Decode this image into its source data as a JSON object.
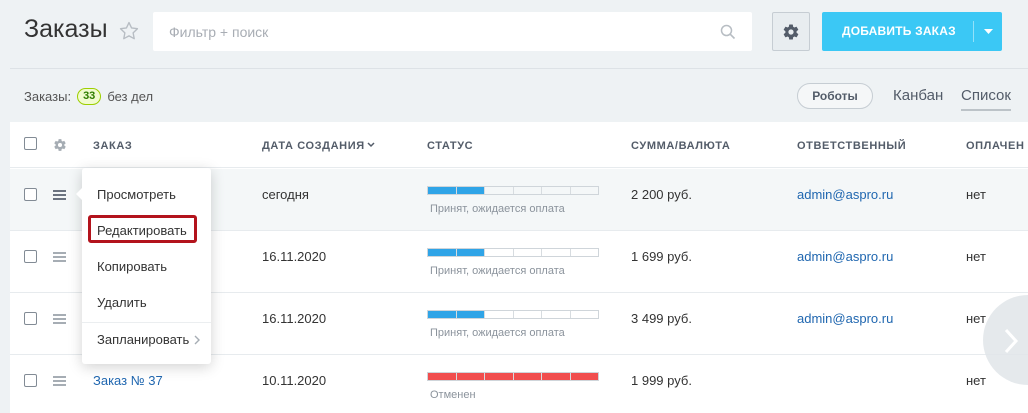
{
  "header": {
    "title": "Заказы",
    "search_placeholder": "Фильтр + поиск",
    "add_button_label": "ДОБАВИТЬ ЗАКАЗ"
  },
  "toolbar": {
    "counter_label": "Заказы:",
    "counter_value": "33",
    "counter_suffix": "без дел",
    "robots_label": "Роботы",
    "view_kanban": "Канбан",
    "view_list": "Список"
  },
  "table": {
    "columns": [
      "ЗАКАЗ",
      "ДАТА СОЗДАНИЯ",
      "СТАТУС",
      "СУММА/ВАЛЮТА",
      "ОТВЕТСТВЕННЫЙ",
      "ОПЛАЧЕН"
    ],
    "rows": [
      {
        "order": "",
        "date": "сегодня",
        "status": "Принят, ожидается оплата",
        "status_progress": 0.25,
        "status_color": "#2fa4e7",
        "sum": "2 200 руб.",
        "responsible": "admin@aspro.ru",
        "paid": "нет"
      },
      {
        "order": "",
        "date": "16.11.2020",
        "status": "Принят, ожидается оплата",
        "status_progress": 0.25,
        "status_color": "#2fa4e7",
        "sum": "1 699 руб.",
        "responsible": "admin@aspro.ru",
        "paid": "нет"
      },
      {
        "order": "",
        "date": "16.11.2020",
        "status": "Принят, ожидается оплата",
        "status_progress": 0.25,
        "status_color": "#2fa4e7",
        "sum": "3 499 руб.",
        "responsible": "admin@aspro.ru",
        "paid": "нет"
      },
      {
        "order": "Заказ № 37",
        "date": "10.11.2020",
        "status": "Отменен",
        "status_progress": 1.0,
        "status_color": "#f14e4e",
        "sum": "1 999 руб.",
        "responsible": "",
        "paid": "нет"
      }
    ]
  },
  "context_menu": {
    "items": [
      "Просмотреть",
      "Редактировать",
      "Копировать",
      "Удалить",
      "Запланировать"
    ],
    "highlighted": "Редактировать"
  },
  "colors": {
    "accent": "#3bc8f5",
    "link": "#2067b0",
    "highlight_border": "#b3131c",
    "badge_border": "#9dcf00"
  }
}
